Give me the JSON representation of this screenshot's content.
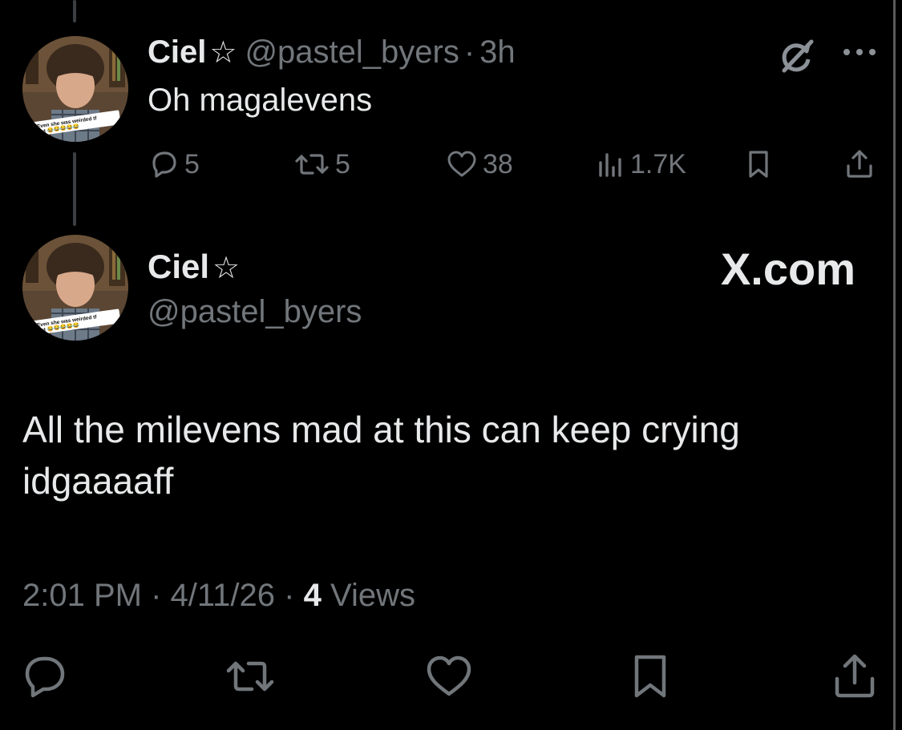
{
  "reply_tweet": {
    "display_name": "Ciel",
    "star": "☆",
    "handle": "@pastel_byers",
    "separator": "·",
    "time_ago": "3h",
    "text": "Oh magalevens",
    "replies": "5",
    "retweets": "5",
    "likes": "38",
    "views": "1.7K"
  },
  "avatar_caption": {
    "line1": "Even she was weirded tf",
    "line2": "out 😂😂😂😂😂"
  },
  "main_tweet": {
    "display_name": "Ciel",
    "star": "☆",
    "handle": "@pastel_byers",
    "watermark": "X.com",
    "text": "All the milevens mad at this can keep crying idgaaaaff",
    "time": "2:01 PM",
    "date": "4/11/26",
    "separator": "·",
    "views_count": "4",
    "views_label": "Views"
  },
  "colors": {
    "background": "#000000",
    "text": "#e7e9ea",
    "muted": "#71767b",
    "thread_line": "#3b3f43"
  },
  "icons": {
    "reply": "reply-icon",
    "retweet": "retweet-icon",
    "like": "like-icon",
    "views": "views-icon",
    "bookmark": "bookmark-icon",
    "share": "share-icon",
    "grok": "grok-icon",
    "more": "more-icon"
  }
}
